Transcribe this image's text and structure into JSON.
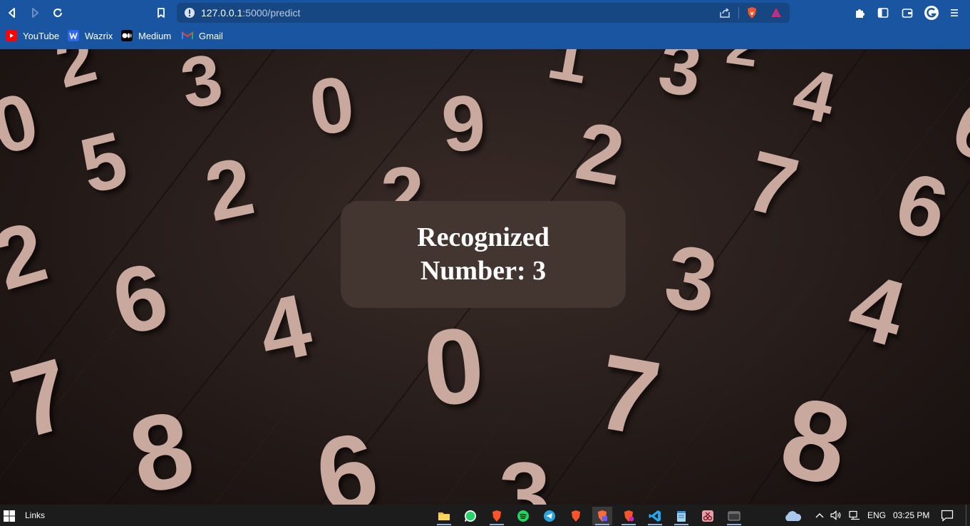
{
  "browser": {
    "url_host": "127.0.0.1",
    "url_path": ":5000/predict",
    "bookmarks": [
      {
        "label": "YouTube",
        "icon": "youtube-icon",
        "color": "#ff0000"
      },
      {
        "label": "Wazrix",
        "icon": "wazirx-icon",
        "color": "#3067f0"
      },
      {
        "label": "Medium",
        "icon": "medium-icon",
        "color": "#000000"
      },
      {
        "label": "Gmail",
        "icon": "gmail-icon",
        "color": "#ea4335"
      }
    ]
  },
  "background_digits": [
    "2",
    "3",
    "0",
    "9",
    "1",
    "3",
    "4",
    "0",
    "5",
    "2",
    "2",
    "2",
    "7",
    "6",
    "2",
    "6",
    "3",
    "6",
    "4",
    "4",
    "7",
    "0",
    "7",
    "8",
    "6",
    "8",
    "3",
    "2"
  ],
  "result": {
    "line1": "Recognized",
    "line2": "Number: 3"
  },
  "taskbar": {
    "links_label": "Links",
    "language": "ENG",
    "time": "03:25 PM",
    "apps": [
      "file-explorer-icon",
      "whatsapp-icon",
      "brave-icon",
      "spotify-icon",
      "telegram-icon",
      "brave-icon",
      "brave-beta-icon",
      "brave-nightly-icon",
      "vscode-icon",
      "notepad-icon",
      "snipping-icon",
      "terminal-icon"
    ]
  },
  "colors": {
    "chrome": "#1a55a1",
    "card": "#433530",
    "digit": "#c9a89d",
    "taskbar": "#1c1c1c"
  }
}
